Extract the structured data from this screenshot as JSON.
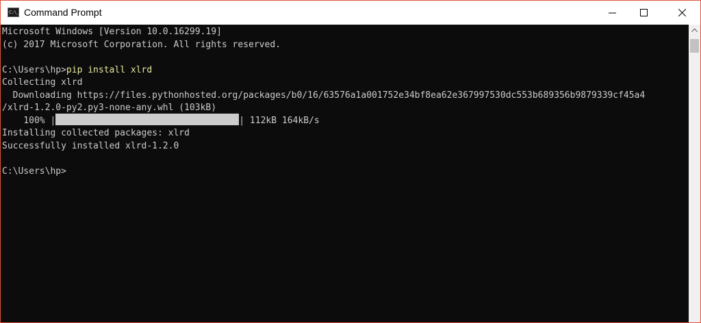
{
  "window": {
    "title": "Command Prompt",
    "app_icon_text": "C:\\_",
    "icons": {
      "app": "cmd-icon",
      "minimize": "minimize-icon",
      "maximize": "maximize-icon",
      "close": "close-icon"
    }
  },
  "console": {
    "lines": [
      "Microsoft Windows [Version 10.0.16299.19]",
      "(c) 2017 Microsoft Corporation. All rights reserved.",
      "",
      "C:\\Users\\hp>",
      "Collecting xlrd",
      "  Downloading https://files.pythonhosted.org/packages/b0/16/63576a1a001752e34bf8ea62e367997530dc553b689356b9879339cf45a4",
      "/xlrd-1.2.0-py2.py3-none-any.whl (103kB)",
      "    100% |",
      "Installing collected packages: xlrd",
      "Successfully installed xlrd-1.2.0",
      "",
      "C:\\Users\\hp>"
    ],
    "command": "pip install xlrd",
    "progress": {
      "percent_label": "100% |",
      "fraction": 1.0,
      "suffix": "| 112kB 164kB/s"
    }
  },
  "colors": {
    "background": "#0c0c0c",
    "foreground": "#cccccc",
    "command_text": "#e8e8a0",
    "window_border": "#e0533a"
  }
}
